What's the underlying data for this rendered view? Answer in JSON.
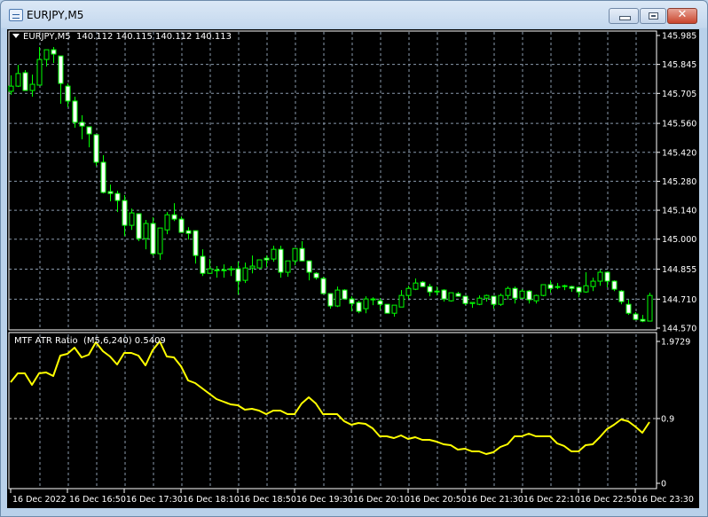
{
  "window": {
    "title": "EURJPY,M5",
    "buttons": [
      "minimize",
      "maximize",
      "close"
    ],
    "close_glyph": "✕"
  },
  "header": {
    "symbol": "EURJPY,M5",
    "ohlc": "140.112 140.115 140.112 140.113"
  },
  "indicator": {
    "label": "MTF ATR Ratio",
    "params": "(M5,6,240)",
    "value": "0.5409"
  },
  "colors": {
    "background": "#000000",
    "candle": "#00ff00",
    "bear_fill": "#ffffff",
    "bull_fill": "#000000",
    "indicator_line": "#ffff00",
    "grid": "#8a9aad"
  },
  "chart_data": [
    {
      "type": "candlestick",
      "grid": true,
      "ylim": [
        144.57,
        145.985
      ],
      "y_ticks": [
        "145.985",
        "145.845",
        "145.705",
        "145.560",
        "145.420",
        "145.280",
        "145.140",
        "145.000",
        "144.855",
        "144.710",
        "144.570"
      ],
      "x_ticks": [
        "16 Dec 2022",
        "16 Dec 16:50",
        "16 Dec 17:30",
        "16 Dec 18:10",
        "16 Dec 18:50",
        "16 Dec 19:30",
        "16 Dec 20:10",
        "16 Dec 20:50",
        "16 Dec 21:30",
        "16 Dec 22:10",
        "16 Dec 22:50",
        "16 Dec 23:30"
      ],
      "ohlc": [
        [
          145.715,
          145.792,
          145.698,
          145.74
        ],
        [
          145.74,
          145.843,
          145.736,
          145.801
        ],
        [
          145.805,
          145.818,
          145.719,
          145.719
        ],
        [
          145.719,
          145.796,
          145.689,
          145.749
        ],
        [
          145.745,
          145.929,
          145.745,
          145.869
        ],
        [
          145.869,
          145.916,
          145.835,
          145.916
        ],
        [
          145.916,
          145.929,
          145.852,
          145.895
        ],
        [
          145.886,
          145.886,
          145.655,
          145.753
        ],
        [
          145.74,
          145.753,
          145.638,
          145.668
        ],
        [
          145.668,
          145.689,
          145.539,
          145.565
        ],
        [
          145.565,
          145.599,
          145.483,
          145.547
        ],
        [
          145.543,
          145.543,
          145.444,
          145.509
        ],
        [
          145.505,
          145.505,
          145.354,
          145.372
        ],
        [
          145.372,
          145.406,
          145.221,
          145.226
        ],
        [
          145.23,
          145.264,
          145.183,
          145.221
        ],
        [
          145.221,
          145.234,
          145.131,
          145.187
        ],
        [
          145.187,
          145.213,
          145.015,
          145.067
        ],
        [
          145.067,
          145.148,
          145.045,
          145.127
        ],
        [
          145.123,
          145.123,
          144.99,
          145.003
        ],
        [
          145.003,
          145.093,
          144.951,
          145.076
        ],
        [
          145.076,
          145.106,
          144.921,
          144.93
        ],
        [
          144.93,
          145.054,
          144.9,
          145.054
        ],
        [
          145.045,
          145.131,
          145.024,
          145.118
        ],
        [
          145.118,
          145.174,
          145.088,
          145.097
        ],
        [
          145.097,
          145.11,
          145.033,
          145.033
        ],
        [
          145.041,
          145.058,
          144.998,
          145.028
        ],
        [
          145.041,
          145.041,
          144.882,
          144.921
        ],
        [
          144.917,
          144.951,
          144.822,
          144.835
        ],
        [
          144.835,
          144.904,
          144.835,
          144.857
        ],
        [
          144.852,
          144.87,
          144.814,
          144.848
        ],
        [
          144.848,
          144.878,
          144.814,
          144.852
        ],
        [
          144.852,
          144.87,
          144.822,
          144.857
        ],
        [
          144.857,
          144.891,
          144.732,
          144.797
        ],
        [
          144.801,
          144.887,
          144.788,
          144.861
        ],
        [
          144.861,
          144.921,
          144.835,
          144.87
        ],
        [
          144.861,
          144.9,
          144.861,
          144.9
        ],
        [
          144.908,
          144.921,
          144.865,
          144.9
        ],
        [
          144.904,
          144.968,
          144.891,
          144.951
        ],
        [
          144.951,
          144.968,
          144.814,
          144.84
        ],
        [
          144.84,
          144.895,
          144.818,
          144.895
        ],
        [
          144.895,
          144.955,
          144.874,
          144.955
        ],
        [
          144.955,
          144.99,
          144.895,
          144.895
        ],
        [
          144.895,
          144.895,
          144.801,
          144.84
        ],
        [
          144.835,
          144.84,
          144.805,
          144.814
        ],
        [
          144.81,
          144.818,
          144.737,
          144.737
        ],
        [
          144.737,
          144.737,
          144.664,
          144.677
        ],
        [
          144.677,
          144.771,
          144.672,
          144.754
        ],
        [
          144.754,
          144.758,
          144.711,
          144.711
        ],
        [
          144.711,
          144.724,
          144.651,
          144.689
        ],
        [
          144.694,
          144.702,
          144.642,
          144.651
        ],
        [
          144.664,
          144.724,
          144.642,
          144.711
        ],
        [
          144.711,
          144.719,
          144.681,
          144.707
        ],
        [
          144.702,
          144.715,
          144.659,
          144.685
        ],
        [
          144.685,
          144.685,
          144.642,
          144.642
        ],
        [
          144.642,
          144.681,
          144.625,
          144.681
        ],
        [
          144.672,
          144.754,
          144.672,
          144.728
        ],
        [
          144.728,
          144.775,
          144.711,
          144.762
        ],
        [
          144.758,
          144.81,
          144.754,
          144.788
        ],
        [
          144.792,
          144.797,
          144.771,
          144.771
        ],
        [
          144.771,
          144.784,
          144.724,
          144.745
        ],
        [
          144.749,
          144.771,
          144.728,
          144.745
        ],
        [
          144.754,
          144.758,
          144.698,
          144.711
        ],
        [
          144.702,
          144.741,
          144.698,
          144.741
        ],
        [
          144.737,
          144.745,
          144.724,
          144.724
        ],
        [
          144.724,
          144.724,
          144.681,
          144.689
        ],
        [
          144.689,
          144.694,
          144.668,
          144.694
        ],
        [
          144.685,
          144.728,
          144.681,
          144.715
        ],
        [
          144.715,
          144.732,
          144.698,
          144.728
        ],
        [
          144.724,
          144.724,
          144.664,
          144.685
        ],
        [
          144.685,
          144.737,
          144.677,
          144.728
        ],
        [
          144.728,
          144.771,
          144.707,
          144.762
        ],
        [
          144.762,
          144.771,
          144.689,
          144.715
        ],
        [
          144.715,
          144.758,
          144.715,
          144.749
        ],
        [
          144.749,
          144.754,
          144.689,
          144.707
        ],
        [
          144.702,
          144.732,
          144.689,
          144.728
        ],
        [
          144.728,
          144.78,
          144.724,
          144.78
        ],
        [
          144.78,
          144.801,
          144.741,
          144.762
        ],
        [
          144.771,
          144.788,
          144.758,
          144.771
        ],
        [
          144.775,
          144.78,
          144.754,
          144.771
        ],
        [
          144.771,
          144.775,
          144.745,
          144.762
        ],
        [
          144.767,
          144.771,
          144.719,
          144.745
        ],
        [
          144.745,
          144.84,
          144.741,
          144.775
        ],
        [
          144.771,
          144.814,
          144.749,
          144.797
        ],
        [
          144.797,
          144.852,
          144.775,
          144.84
        ],
        [
          144.84,
          144.844,
          144.767,
          144.797
        ],
        [
          144.797,
          144.801,
          144.749,
          144.758
        ],
        [
          144.749,
          144.754,
          144.685,
          144.698
        ],
        [
          144.685,
          144.707,
          144.634,
          144.642
        ],
        [
          144.638,
          144.647,
          144.608,
          144.612
        ],
        [
          144.612,
          144.634,
          144.599,
          144.604
        ],
        [
          144.604,
          144.741,
          144.604,
          144.728
        ]
      ]
    },
    {
      "type": "line",
      "grid": true,
      "ylim": [
        0,
        1.9729
      ],
      "y_ticks": [
        "1.9729",
        "0.9",
        "0"
      ],
      "level": 0.9,
      "values": [
        1.406,
        1.529,
        1.529,
        1.369,
        1.529,
        1.541,
        1.492,
        1.776,
        1.8,
        1.886,
        1.751,
        1.788,
        1.96,
        1.837,
        1.763,
        1.652,
        1.813,
        1.813,
        1.776,
        1.64,
        1.85,
        1.973,
        1.763,
        1.751,
        1.628,
        1.43,
        1.393,
        1.319,
        1.245,
        1.171,
        1.134,
        1.097,
        1.085,
        1.023,
        1.036,
        1.011,
        0.962,
        1.011,
        1.011,
        0.962,
        0.962,
        1.11,
        1.196,
        1.11,
        0.962,
        0.962,
        0.962,
        0.863,
        0.814,
        0.838,
        0.826,
        0.764,
        0.653,
        0.653,
        0.629,
        0.666,
        0.617,
        0.641,
        0.604,
        0.604,
        0.58,
        0.543,
        0.53,
        0.469,
        0.481,
        0.444,
        0.444,
        0.407,
        0.432,
        0.506,
        0.543,
        0.653,
        0.653,
        0.69,
        0.653,
        0.653,
        0.653,
        0.555,
        0.518,
        0.444,
        0.444,
        0.53,
        0.543,
        0.641,
        0.752,
        0.814,
        0.888,
        0.863,
        0.789,
        0.703,
        0.851
      ]
    }
  ]
}
